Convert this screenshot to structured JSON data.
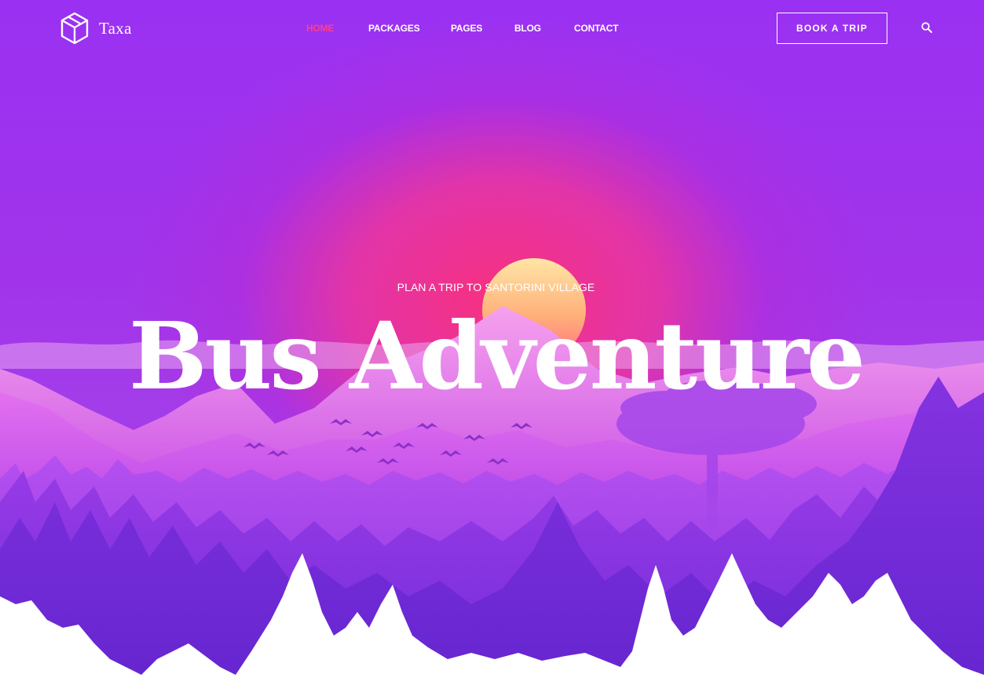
{
  "brand": {
    "name": "Taxa",
    "logo_icon": "cube-icon"
  },
  "nav": {
    "items": [
      {
        "label": "HOME",
        "active": true
      },
      {
        "label": "PACKAGES",
        "active": false
      },
      {
        "label": "PAGES",
        "active": false
      },
      {
        "label": "BLOG",
        "active": false
      },
      {
        "label": "CONTACT",
        "active": false
      }
    ]
  },
  "header": {
    "cta_label": "BOOK A TRIP",
    "search_icon": "search-icon"
  },
  "hero": {
    "subtitle": "PLAN A TRIP TO SANTORINI VILLAGE",
    "title": "Bus Adventure"
  },
  "colors": {
    "accent": "#ff3e8d",
    "background_top": "#9a31f2",
    "glow": "#f7307f",
    "sun": "#ffc98a"
  }
}
